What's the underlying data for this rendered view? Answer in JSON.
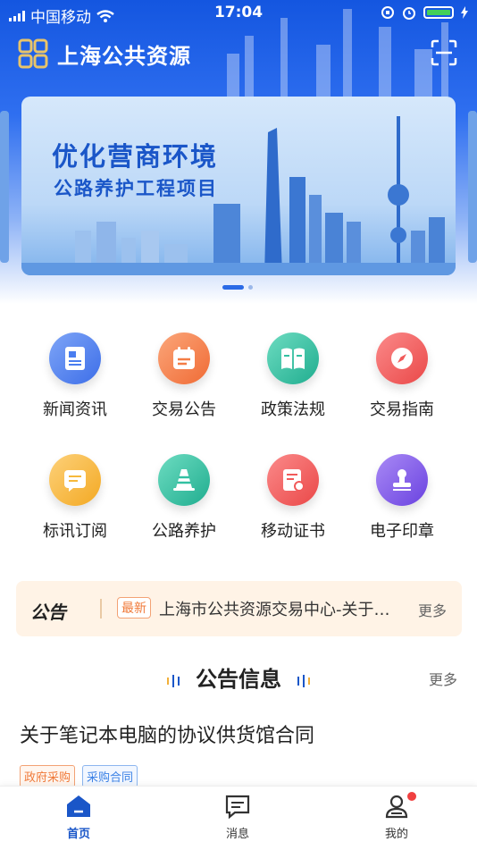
{
  "status_bar": {
    "carrier": "中国移动",
    "time": "17:04"
  },
  "header": {
    "title": "上海公共资源"
  },
  "banner": {
    "headline": "优化营商环境",
    "subline": "公路养护工程项目"
  },
  "quick_menu": [
    {
      "label": "新闻资讯",
      "icon": "news-icon",
      "color": "#4a7ef0"
    },
    {
      "label": "交易公告",
      "icon": "calendar-icon",
      "color": "#f47d45"
    },
    {
      "label": "政策法规",
      "icon": "book-icon",
      "color": "#33c0a2"
    },
    {
      "label": "交易指南",
      "icon": "compass-icon",
      "color": "#f15a5a"
    },
    {
      "label": "标讯订阅",
      "icon": "subscribe-icon",
      "color": "#f6b93b"
    },
    {
      "label": "公路养护",
      "icon": "road-cone-icon",
      "color": "#33c0a2"
    },
    {
      "label": "移动证书",
      "icon": "certificate-icon",
      "color": "#f15a5a"
    },
    {
      "label": "电子印章",
      "icon": "seal-icon",
      "color": "#7b55e6"
    }
  ],
  "notice": {
    "tag": "公告",
    "badge": "最新",
    "text": "上海市公共资源交易中心-关于…",
    "more": "更多"
  },
  "section": {
    "title": "公告信息",
    "more": "更多"
  },
  "articles": [
    {
      "title": "关于笔记本电脑的协议供货馆合同",
      "tags": [
        "政府采购",
        "采购合同"
      ]
    }
  ],
  "tabbar": {
    "items": [
      {
        "label": "首页",
        "icon": "home-icon",
        "active": true
      },
      {
        "label": "消息",
        "icon": "message-icon",
        "active": false
      },
      {
        "label": "我的",
        "icon": "profile-icon",
        "active": false
      }
    ]
  },
  "colors": {
    "primary": "#1a56c8",
    "accent_orange": "#f07a3a",
    "badge_red": "#f04040"
  }
}
